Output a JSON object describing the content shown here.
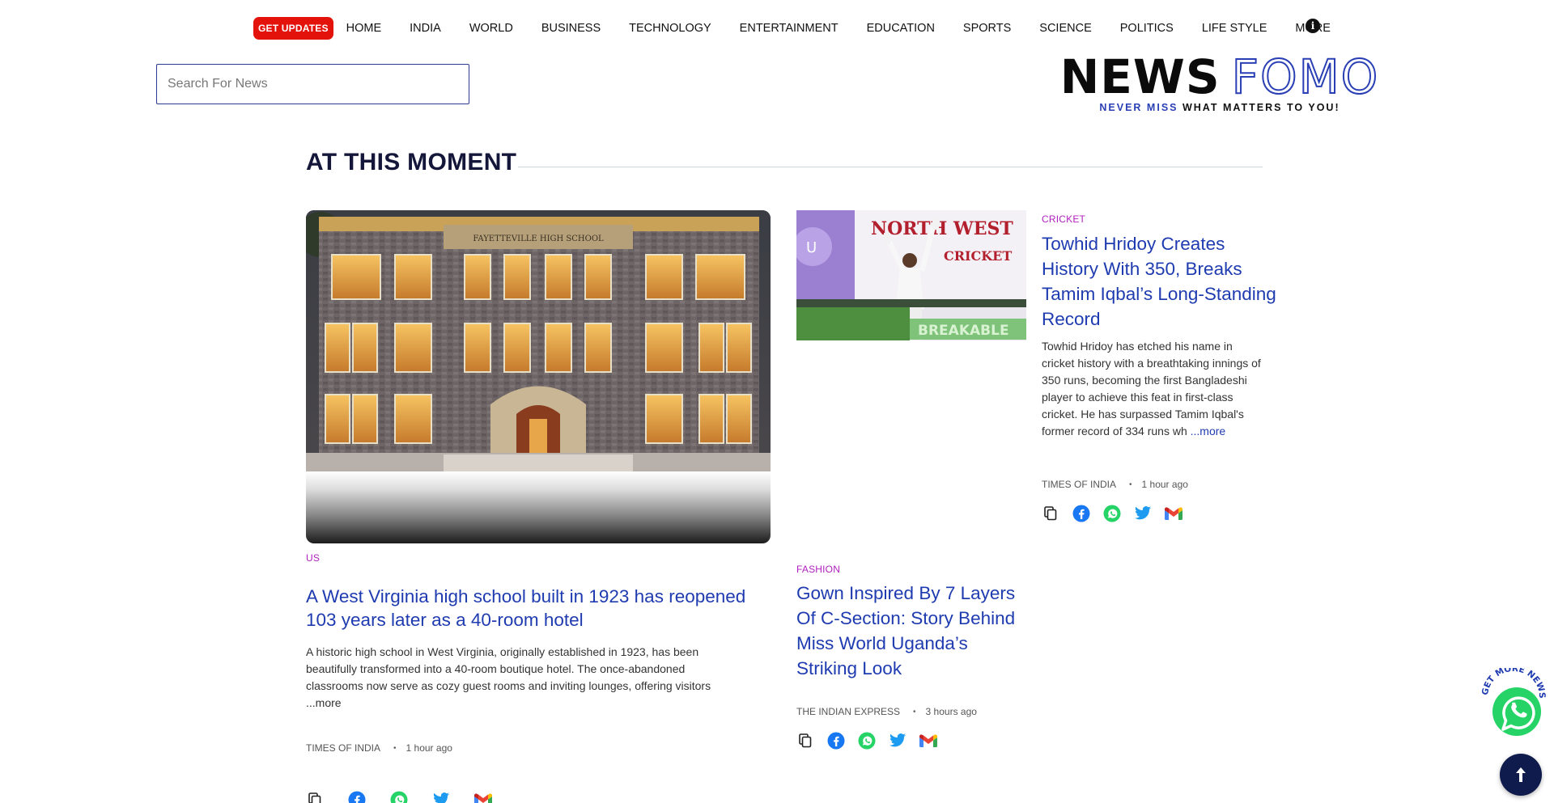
{
  "nav": {
    "get_updates": "GET UPDATES",
    "items": [
      "HOME",
      "INDIA",
      "WORLD",
      "BUSINESS",
      "TECHNOLOGY",
      "ENTERTAINMENT",
      "EDUCATION",
      "SPORTS",
      "SCIENCE",
      "POLITICS",
      "LIFE STYLE",
      "MORE"
    ],
    "info_icon": "info-icon"
  },
  "search": {
    "placeholder": "Search For News",
    "value": ""
  },
  "logo": {
    "word1": "NEWS",
    "word2": "FOMO",
    "tagline_blue": "NEVER MISS",
    "tagline_rest": "WHAT MATTERS TO YOU!"
  },
  "section": {
    "title": "AT THIS MOMENT"
  },
  "articles": [
    {
      "tag": "US",
      "headline": "A West Virginia high school built in 1923 has reopened 103 years later as a 40-room hotel",
      "description": "A historic high school in West Virginia, originally established in 1923, has been beautifully transformed into a 40-room boutique hotel. The once-abandoned classrooms now serve as cozy guest rooms and inviting lounges, offering visitors ",
      "more": "...more",
      "source": "TIMES OF INDIA",
      "time": "1 hour ago",
      "image_sign": "FAYETTEVILLE HIGH SCHOOL"
    },
    {
      "tag": "CRICKET",
      "headline": "Towhid Hridoy Creates History With 350, Breaks Tamim Iqbal’s Long-Standing Record",
      "description": "Towhid Hridoy has etched his name in cricket history with a breathtaking innings of 350 runs, becoming the first Bangladeshi player to achieve this feat in first-class cricket. He has surpassed Tamim Iqbal's former record of 334 runs wh ",
      "more": "...more",
      "source": "TIMES OF INDIA",
      "time": "1 hour ago",
      "image_sign_1": "NORTH WEST",
      "image_sign_2": "CRICKET",
      "image_banner": "BREAKABLE"
    },
    {
      "tag": "FASHION",
      "headline": "Gown Inspired By 7 Layers Of C-Section: Story Behind Miss World Uganda’s Striking Look",
      "source": "THE INDIAN EXPRESS",
      "time": "3 hours ago"
    }
  ],
  "share_icons": [
    "copy-icon",
    "facebook-icon",
    "whatsapp-icon",
    "twitter-icon",
    "gmail-icon"
  ],
  "float": {
    "whatsapp_label": "GET MORE NEWS ON",
    "to_top_icon": "arrow-up-icon"
  },
  "colors": {
    "accent_blue": "#1f3bb0",
    "tag_purple": "#b01fbf",
    "get_updates_red": "#e3120b",
    "navy": "#0f1b4c"
  }
}
